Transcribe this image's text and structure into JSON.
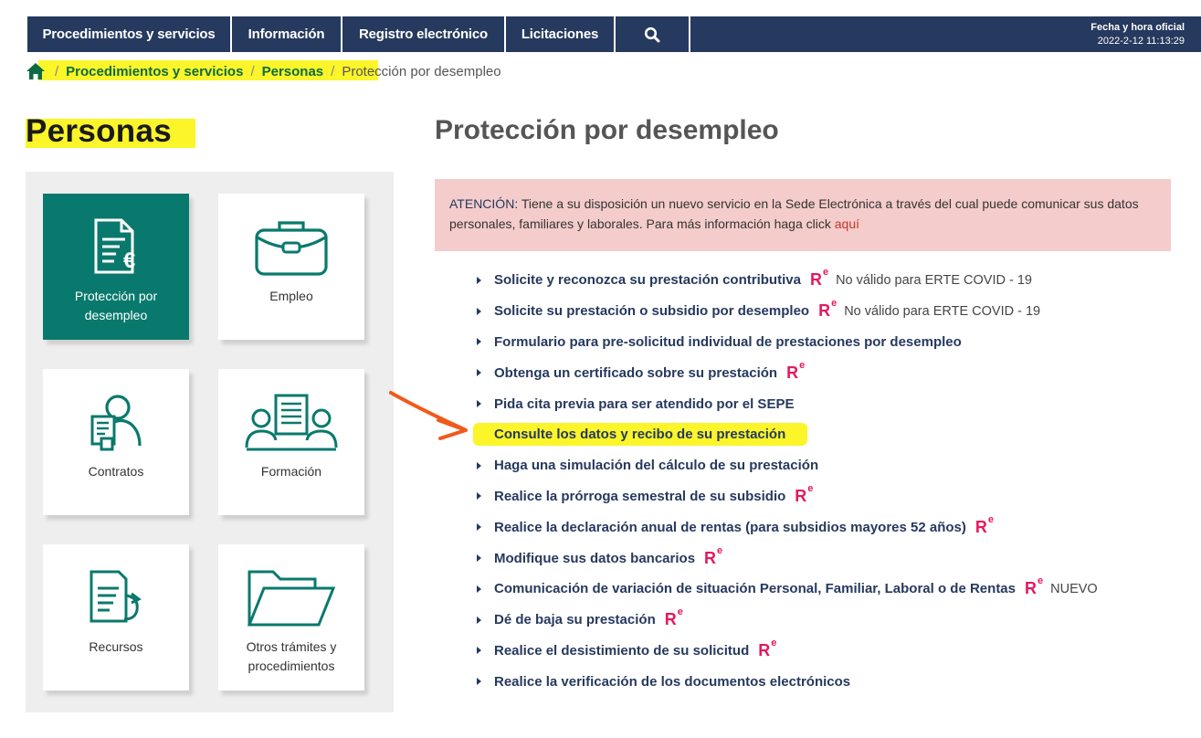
{
  "nav": {
    "items": [
      "Procedimientos y servicios",
      "Información",
      "Registro electrónico",
      "Licitaciones"
    ],
    "datetime_title": "Fecha y hora oficial",
    "datetime_value": "2022-2-12   11:13:29"
  },
  "breadcrumb": {
    "items": [
      "Procedimientos y servicios",
      "Personas"
    ],
    "current": "Protección por desempleo"
  },
  "left": {
    "title": "Personas",
    "cards": [
      {
        "label": "Protección por desempleo",
        "icon": "document-euro-icon",
        "active": true
      },
      {
        "label": "Empleo",
        "icon": "briefcase-icon",
        "active": false
      },
      {
        "label": "Contratos",
        "icon": "contract-person-icon",
        "active": false
      },
      {
        "label": "Formación",
        "icon": "training-icon",
        "active": false
      },
      {
        "label": "Recursos",
        "icon": "appeal-document-icon",
        "active": false
      },
      {
        "label": "Otros trámites y procedimientos",
        "icon": "folder-icon",
        "active": false
      }
    ]
  },
  "main": {
    "title": "Protección por desempleo",
    "alert": {
      "strong": "ATENCIÓN",
      "text": ": Tiene a su disposición un nuevo servicio en la Sede Electrónica a través del cual puede comunicar sus datos personales, familiares y laborales. Para más información haga click ",
      "link": "aquí"
    },
    "re_label": "R",
    "re_sup": "e",
    "services": [
      {
        "label": "Solicite y reconozca su prestación contributiva",
        "re": true,
        "note": "No válido para ERTE COVID - 19"
      },
      {
        "label": "Solicite su prestación o subsidio por desempleo",
        "re": true,
        "note": "No válido para ERTE COVID - 19"
      },
      {
        "label": "Formulario para pre-solicitud individual de prestaciones por desempleo",
        "re": false,
        "note": ""
      },
      {
        "label": "Obtenga un certificado sobre su prestación",
        "re": true,
        "note": ""
      },
      {
        "label": "Pida cita previa para ser atendido por el SEPE",
        "re": false,
        "note": ""
      },
      {
        "label": "Consulte los datos y recibo de su prestación",
        "re": false,
        "note": "",
        "highlighted": true
      },
      {
        "label": "Haga una simulación del cálculo de su prestación",
        "re": false,
        "note": ""
      },
      {
        "label": "Realice la prórroga semestral de su subsidio",
        "re": true,
        "note": ""
      },
      {
        "label": "Realice la declaración anual de rentas (para subsidios mayores 52 años)",
        "re": true,
        "note": ""
      },
      {
        "label": "Modifique sus datos bancarios",
        "re": true,
        "note": ""
      },
      {
        "label": "Comunicación de variación de situación Personal, Familiar, Laboral o de Rentas",
        "re": true,
        "note": "NUEVO"
      },
      {
        "label": "Dé de baja su prestación",
        "re": true,
        "note": ""
      },
      {
        "label": "Realice el desistimiento de su solicitud",
        "re": true,
        "note": ""
      },
      {
        "label": "Realice la verificación de los documentos electrónicos",
        "re": false,
        "note": ""
      }
    ]
  },
  "colors": {
    "nav_bg": "#26395e",
    "accent_green": "#09796d",
    "highlight": "#fbf52a",
    "re_pink": "#e8175d",
    "alert_bg": "#f4cccb",
    "annotation_arrow": "#f05a1a"
  }
}
